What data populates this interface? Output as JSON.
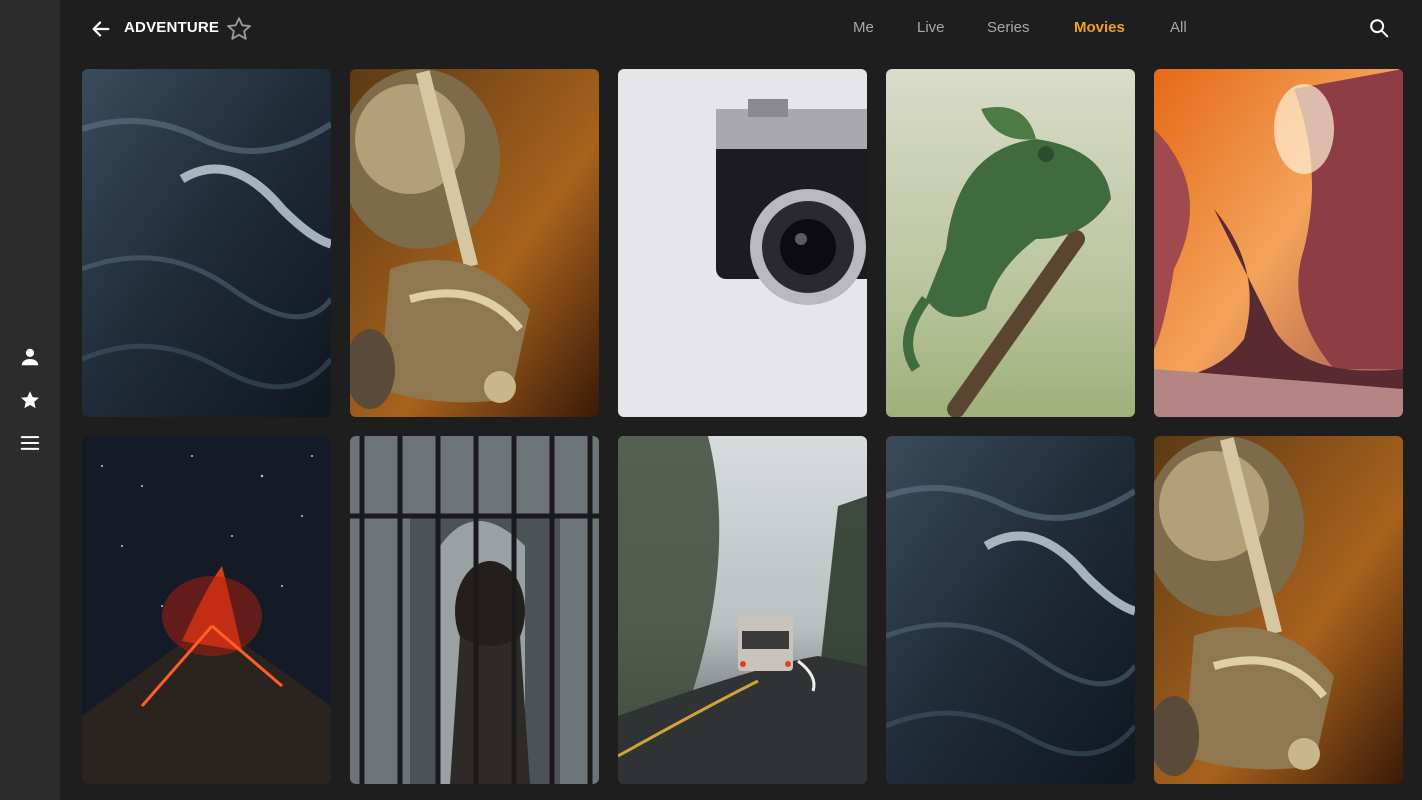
{
  "header": {
    "title": "ADVENTURE",
    "back_icon": "arrow-left-icon",
    "favorite_icon": "star-outline-icon",
    "search_icon": "search-icon"
  },
  "tabs": [
    {
      "label": "Me",
      "active": false
    },
    {
      "label": "Live",
      "active": false
    },
    {
      "label": "Series",
      "active": false
    },
    {
      "label": "Movies",
      "active": true
    },
    {
      "label": "All",
      "active": false
    }
  ],
  "sidebar": {
    "items": [
      {
        "icon": "person-icon"
      },
      {
        "icon": "star-icon"
      },
      {
        "icon": "hamburger-menu-icon"
      }
    ]
  },
  "colors": {
    "background": "#1e1e1e",
    "sidebar": "#2c2c2c",
    "accent": "#f0a21d",
    "tab_inactive": "#a8a8a8"
  },
  "grid": {
    "rows": [
      [
        {
          "subject": "ocean-waves"
        },
        {
          "subject": "knight-armor-sword"
        },
        {
          "subject": "vintage-camera"
        },
        {
          "subject": "chameleon"
        },
        {
          "subject": "sandstone-canyon"
        }
      ],
      [
        {
          "subject": "erupting-volcano"
        },
        {
          "subject": "person-behind-bars"
        },
        {
          "subject": "van-on-foggy-road"
        },
        {
          "subject": "ocean-waves"
        },
        {
          "subject": "knight-armor-sword"
        }
      ]
    ]
  }
}
